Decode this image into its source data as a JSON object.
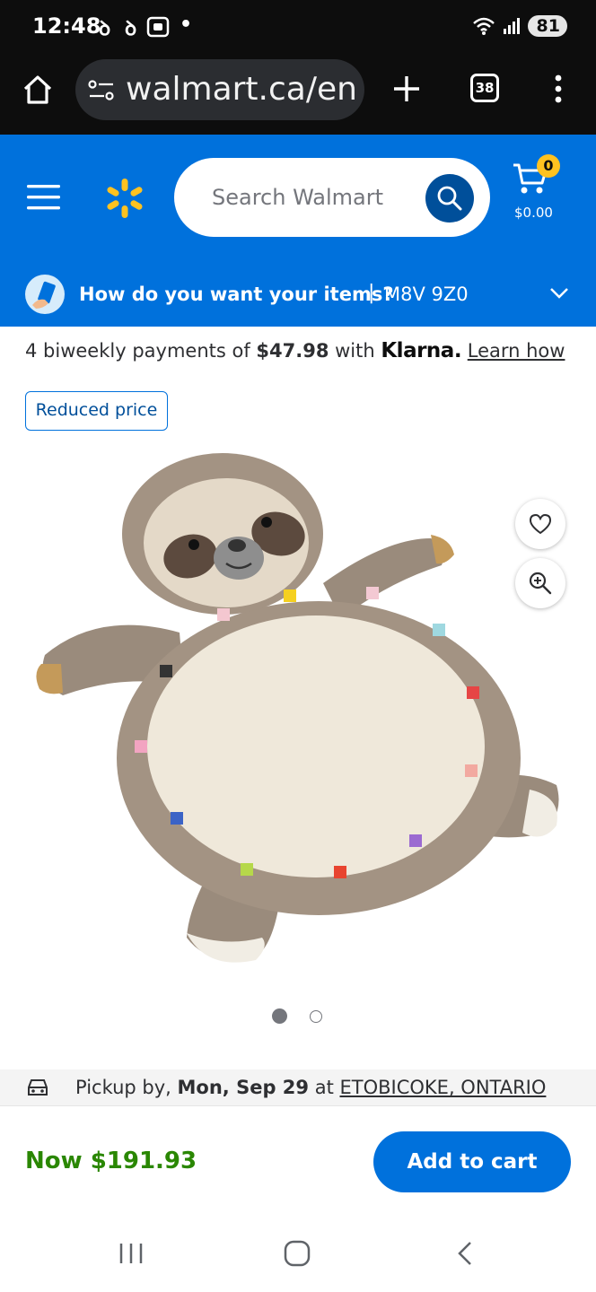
{
  "status_bar": {
    "time": "12:48",
    "notif_1": "ꝺ",
    "notif_2": "ꝺ",
    "dot": "•",
    "battery": "81"
  },
  "browser": {
    "url": "walmart.ca/en",
    "tab_count": "38"
  },
  "header": {
    "search_placeholder": "Search Walmart",
    "cart_count": "0",
    "cart_total": "$0.00"
  },
  "delivery": {
    "question": "How do you want your items?",
    "separator": "|",
    "postal_code": "M8V 9Z0"
  },
  "payments": {
    "prefix": "4 biweekly payments of ",
    "amount": "$47.98",
    "mid": " with ",
    "brand": "Klarna.",
    "link": "Learn how"
  },
  "badge": {
    "label": "Reduced price"
  },
  "gallery": {
    "current_index": 1,
    "total": 2
  },
  "pickup": {
    "prefix": "Pickup by, ",
    "date": "Mon, Sep 29",
    "at": " at ",
    "location": "ETOBICOKE, ONTARIO"
  },
  "purchase": {
    "price": "Now $191.93",
    "add_to_cart": "Add to cart"
  },
  "colors": {
    "walmart_blue": "#0071dc",
    "walmart_yellow": "#ffc220",
    "price_green": "#2a8703"
  }
}
